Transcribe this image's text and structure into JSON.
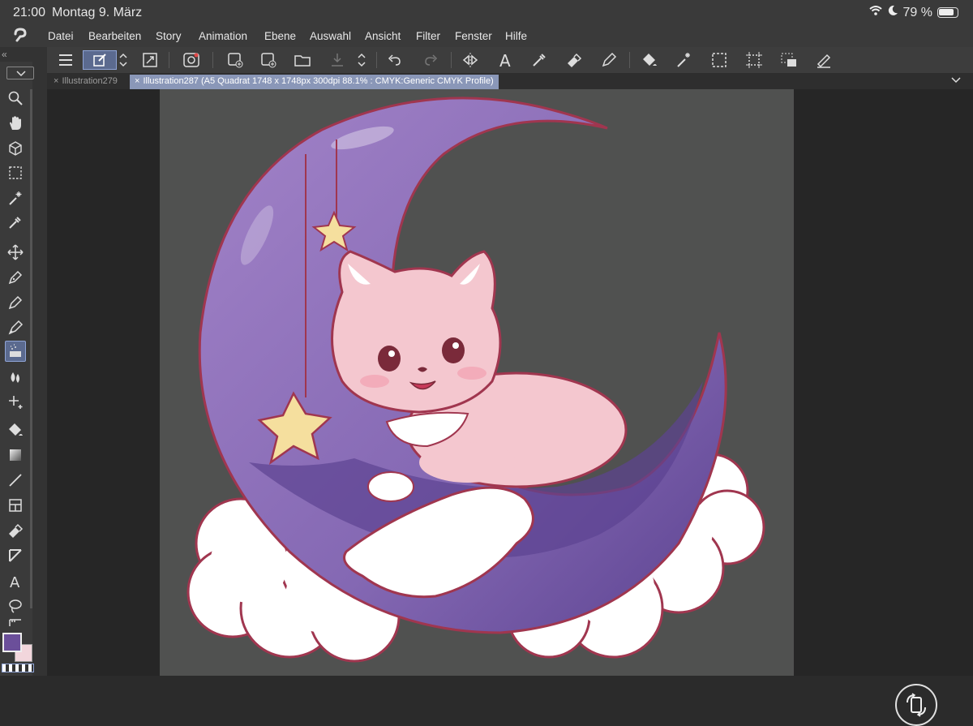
{
  "status": {
    "time": "21:00",
    "date": "Montag 9. März",
    "battery": "79 %"
  },
  "menu": {
    "items": [
      "Datei",
      "Bearbeiten",
      "Story",
      "Animation",
      "Ebene",
      "Auswahl",
      "Ansicht",
      "Filter",
      "Fenster",
      "Hilfe"
    ]
  },
  "tabs": [
    {
      "label": "Illustration279"
    },
    {
      "label": "Illustration287 (A5 Quadrat 1748 x 1748px 300dpi 88.1% : CMYK:Generic CMYK Profile)"
    }
  ],
  "colors": {
    "main": "#6b4f9a",
    "sub": "#f2d6dc",
    "canvas_bg": "#505150",
    "active_tab": "#8a97b8",
    "moon_purple": "#8a6bb5",
    "cat_pink": "#f4c7cf",
    "star_yellow": "#f5df9e"
  },
  "icons": {
    "toolbar": [
      "menu-icon",
      "cursor-select-icon",
      "stepper-icon",
      "transform-icon",
      "recording-icon",
      "new-layer-icon",
      "new-vector-layer-icon",
      "open-folder-icon",
      "save-icon",
      "stepper-icon",
      "undo-icon",
      "redo-icon",
      "flip-icon",
      "text-icon",
      "eyedropper-icon",
      "eraser-icon",
      "pen-icon",
      "fill-icon",
      "magic-wand-icon",
      "rect-select-icon",
      "crop-icon",
      "selection-layer-icon",
      "pencil-edit-icon"
    ],
    "left": [
      "zoom-icon",
      "hand-icon",
      "3d-icon",
      "rect-select-icon",
      "magic-wand-icon",
      "eyedropper-icon",
      "move-icon",
      "pen-icon",
      "pencil-icon",
      "brush-icon",
      "airbrush-icon",
      "blend-icon",
      "decoration-icon",
      "fill-icon",
      "gradient-icon",
      "line-icon",
      "frame-icon",
      "eraser-icon",
      "correction-icon",
      "text-icon",
      "lasso-icon",
      "ruler-icon"
    ]
  }
}
